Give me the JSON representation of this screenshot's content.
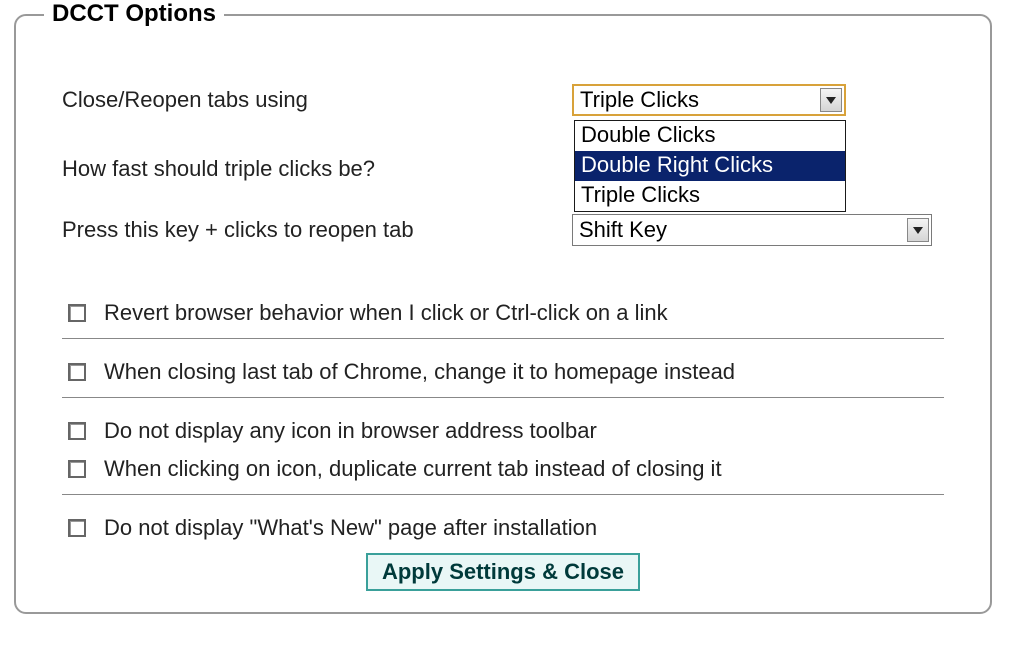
{
  "legend": "DCCT Options",
  "rows": {
    "close_reopen_label": "Close/Reopen tabs using",
    "triple_speed_label": "How fast should triple clicks be?",
    "reopen_key_label": "Press this key + clicks to reopen tab"
  },
  "select1": {
    "value": "Triple Clicks",
    "options": [
      "Double Clicks",
      "Double Right Clicks",
      "Triple Clicks"
    ],
    "highlighted": "Double Right Clicks"
  },
  "select2": {
    "value": "Shift Key"
  },
  "checkboxes": {
    "c1": "Revert browser behavior when I click or Ctrl-click on a link",
    "c2": "When closing last tab of Chrome, change it to homepage instead",
    "c3": "Do not display any icon in browser address toolbar",
    "c4": "When clicking on icon, duplicate current tab instead of closing it",
    "c5": "Do not display \"What's New\" page after installation"
  },
  "apply_label": "Apply Settings & Close"
}
